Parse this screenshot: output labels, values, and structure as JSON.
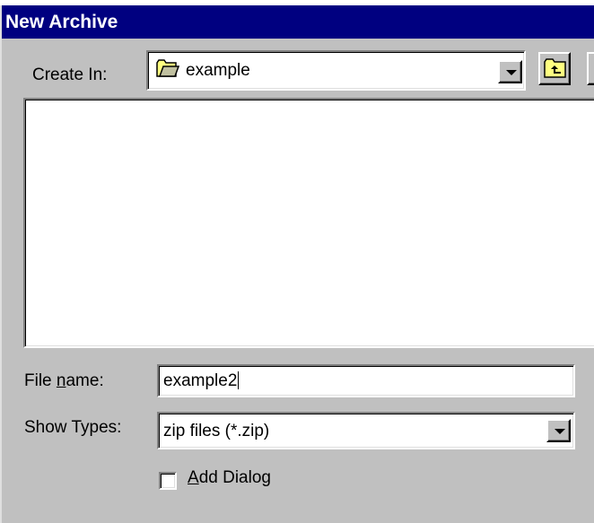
{
  "window": {
    "title": "New Archive"
  },
  "create_in": {
    "label": "Create In:",
    "value": "example",
    "folder_icon": "folder-icon",
    "up_icon": "up-folder-icon"
  },
  "file_name": {
    "label_pre": "File ",
    "label_accel": "n",
    "label_post": "ame:",
    "value": "example2"
  },
  "show_types": {
    "label": "Show Types:",
    "value": "zip files (*.zip)"
  },
  "add_dialog": {
    "accel": "A",
    "label_rest": "dd Dialog",
    "checked": false
  },
  "colors": {
    "titlebar": "#000080",
    "face": "#c0c0c0",
    "folder": "#ffff80"
  }
}
